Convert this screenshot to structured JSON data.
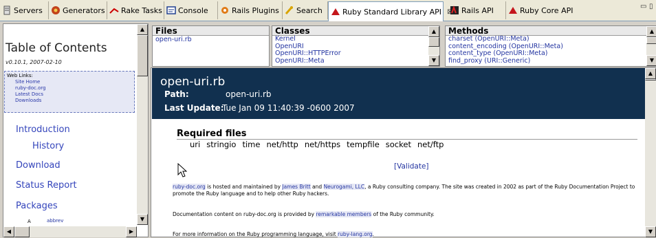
{
  "tabs": [
    {
      "label": "Servers",
      "icon": "server-icon"
    },
    {
      "label": "Generators",
      "icon": "generators-icon"
    },
    {
      "label": "Rake Tasks",
      "icon": "rake-icon"
    },
    {
      "label": "Console",
      "icon": "console-icon"
    },
    {
      "label": "Rails Plugins",
      "icon": "plugins-icon"
    },
    {
      "label": "Search",
      "icon": "search-icon"
    },
    {
      "label": "Ruby Standard Library API",
      "icon": "ruby-icon",
      "close": "⊠"
    },
    {
      "label": "Rails API",
      "icon": "rails-icon"
    },
    {
      "label": "Ruby Core API",
      "icon": "ruby-icon"
    }
  ],
  "toc": {
    "title": "Table of Contents",
    "version": "v0.10.1, 2007-02-10",
    "web_links_label": "Web Links:",
    "web_links": [
      "Site Home",
      "ruby-doc.org",
      "Latest Docs",
      "Downloads"
    ],
    "nav": [
      "Introduction",
      "History",
      "Download",
      "Status Report",
      "Packages"
    ],
    "packages_row": {
      "letter": "A",
      "item": "abbrev"
    }
  },
  "files": {
    "header": "Files",
    "items": [
      "open-uri.rb"
    ]
  },
  "classes": {
    "header": "Classes",
    "items": [
      "Kernel",
      "OpenURI",
      "OpenURI::HTTPError",
      "OpenURI::Meta"
    ]
  },
  "methods": {
    "header": "Methods",
    "items": [
      "charset (OpenURI::Meta)",
      "content_encoding (OpenURI::Meta)",
      "content_type (OpenURI::Meta)",
      "find_proxy (URI::Generic)"
    ]
  },
  "doc": {
    "title": "open-uri.rb",
    "path_label": "Path:",
    "path_value": "open-uri.rb",
    "update_label": "Last Update:",
    "update_value": "Tue Jan 09 11:40:39 -0600 2007",
    "required_title": "Required files",
    "required": [
      "uri",
      "stringio",
      "time",
      "net/http",
      "net/https",
      "tempfile",
      "socket",
      "net/ftp"
    ],
    "validate": "[Validate]",
    "p1a": "ruby-doc.org",
    "p1b": " is hosted and maintained by ",
    "p1c": "James Britt",
    "p1d": " and ",
    "p1e": "Neurogami, LLC",
    "p1f": ", a Ruby consulting company. The site was created in 2002 as part of the Ruby Documentation Project to promote the Ruby language and to help other Ruby hackers.",
    "p2a": "Documentation content on ruby-doc.org is provided by ",
    "p2b": "remarkable members",
    "p2c": " of the Ruby community.",
    "p3a": "For more information on the Ruby programming language, visit ",
    "p3b": "ruby-lang.org",
    "p3c": "."
  }
}
